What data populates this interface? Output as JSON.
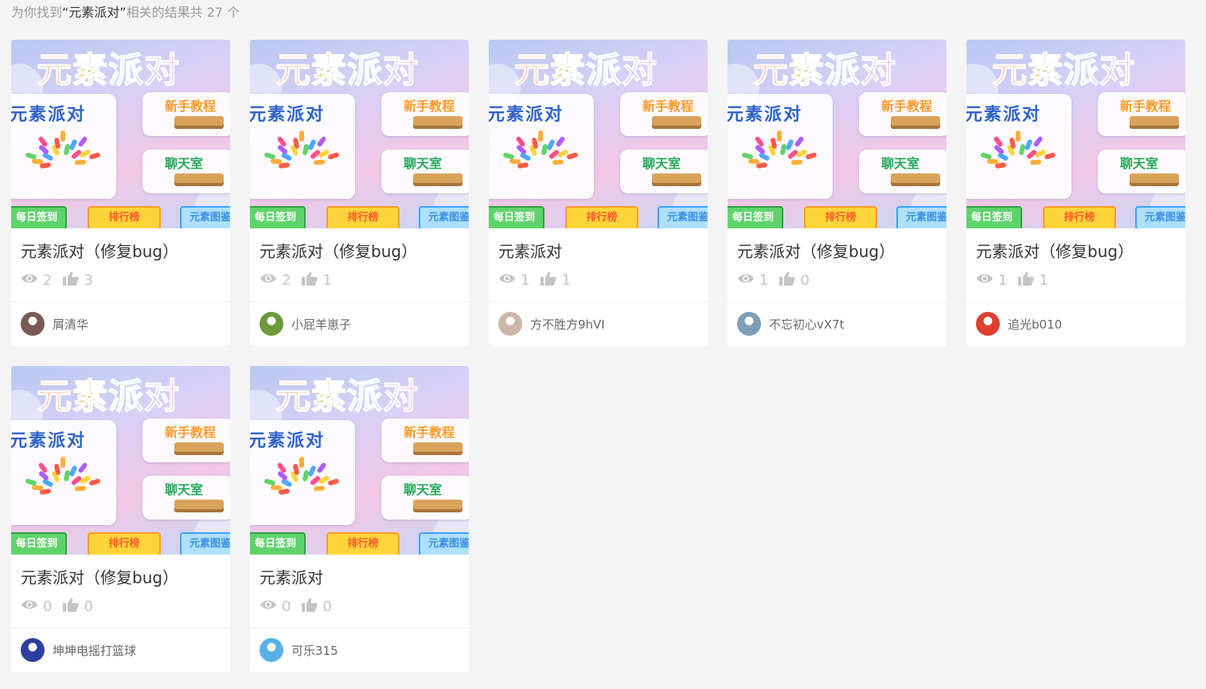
{
  "search": {
    "prefix": "为你找到",
    "keyword": "“元素派对”",
    "suffix": "相关的结果共 27 个"
  },
  "thumbnail_text": {
    "big_title": "元素派对",
    "panel_title": "元素派对",
    "tutorial": "新手教程",
    "chatroom": "聊天室",
    "signin": "每日签到",
    "ranking": "排行榜",
    "elements": "元素图鉴"
  },
  "colors": {
    "page_bg": "#f4f4f4",
    "card_bg": "#ffffff",
    "title_text": "#333333",
    "meta_text": "#c4c4c4",
    "author_text": "#666666"
  },
  "cards": [
    {
      "title": "元素派对（修复bug）",
      "views": "2",
      "likes": "3",
      "author": "屑清华",
      "avatar_color": "#7a5a55",
      "avatar_icon": "ultraman-avatar"
    },
    {
      "title": "元素派对（修复bug）",
      "views": "2",
      "likes": "1",
      "author": "小屁羊崽子",
      "avatar_color": "#6c9a3c",
      "avatar_icon": "sheep-avatar"
    },
    {
      "title": "元素派对",
      "views": "1",
      "likes": "1",
      "author": "方不胜方9hVI",
      "avatar_color": "#cdb7a8",
      "avatar_icon": "paper-avatar"
    },
    {
      "title": "元素派对（修复bug）",
      "views": "1",
      "likes": "0",
      "author": "不忘初心vX7t",
      "avatar_color": "#7f9fb8",
      "avatar_icon": "landscape-avatar"
    },
    {
      "title": "元素派对（修复bug）",
      "views": "1",
      "likes": "1",
      "author": "追光b010",
      "avatar_color": "#e04030",
      "avatar_icon": "mushroom-avatar"
    },
    {
      "title": "元素派对（修复bug）",
      "views": "0",
      "likes": "0",
      "author": "坤坤电摇打篮球",
      "avatar_color": "#2b3f9e",
      "avatar_icon": "cartoon-avatar"
    },
    {
      "title": "元素派对",
      "views": "0",
      "likes": "0",
      "author": "可乐315",
      "avatar_color": "#5ab0e8",
      "avatar_icon": "bird-avatar"
    }
  ]
}
